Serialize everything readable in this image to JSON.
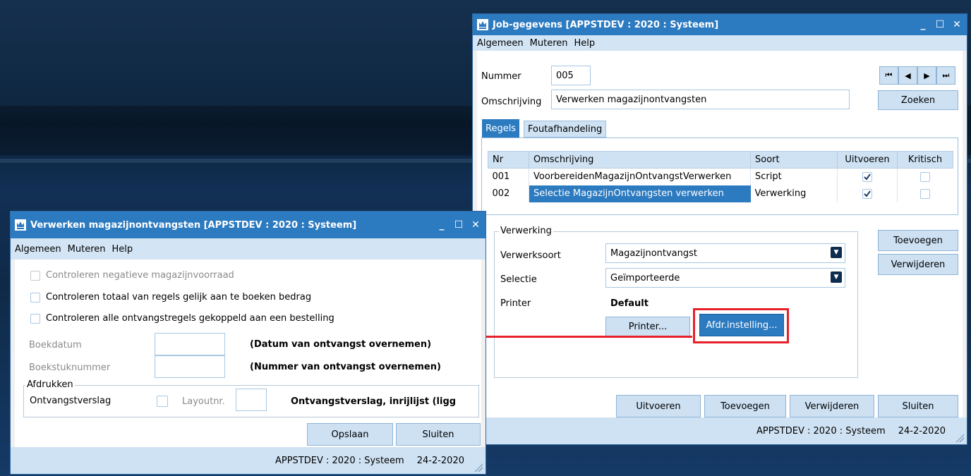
{
  "main_window": {
    "title": "Job-gegevens  [APPSTDEV : 2020 : Systeem]",
    "menu": [
      "Algemeen",
      "Muteren",
      "Help"
    ],
    "nummer_label": "Nummer",
    "nummer_value": "005",
    "omschrijving_label": "Omschrijving",
    "omschrijving_value": "Verwerken magazijnontvangsten",
    "nav_buttons": [
      "⏮",
      "◀",
      "▶",
      "⏭"
    ],
    "zoeken_button": "Zoeken",
    "tabs": [
      "Regels",
      "Foutafhandeling"
    ],
    "grid": {
      "columns": [
        "Nr",
        "Omschrijving",
        "Soort",
        "Uitvoeren",
        "Kritisch"
      ],
      "rows": [
        {
          "nr": "001",
          "omschrijving": "VoorbereidenMagazijnOntvangstVerwerken",
          "soort": "Script",
          "uitvoeren": true,
          "kritisch": false
        },
        {
          "nr": "002",
          "omschrijving": "Selectie MagazijnOntvangsten verwerken",
          "soort": "Verwerking",
          "uitvoeren": true,
          "kritisch": false
        }
      ]
    },
    "verwerking_group_label": "Verwerking",
    "verwerkssoort_label": "Verwerksoort",
    "verwerkssoort_value": "Magazijnontvangst",
    "selectie_label": "Selectie",
    "selectie_value": "Geïmporteerde",
    "printer_label": "Printer",
    "printer_value": "Default",
    "printer_button": "Printer...",
    "afdr_button": "Afdr.instelling...",
    "side_buttons": [
      "Toevoegen",
      "Verwijderen"
    ],
    "bottom_buttons": [
      "Uitvoeren",
      "Toevoegen",
      "Verwijderen",
      "Sluiten"
    ],
    "status_text": "APPSTDEV : 2020 : Systeem",
    "status_date": "24-2-2020"
  },
  "sub_window": {
    "title": "Verwerken magazijnontvangsten  [APPSTDEV : 2020 : Systeem]",
    "menu": [
      "Algemeen",
      "Muteren",
      "Help"
    ],
    "checkboxes": [
      {
        "label": "Controleren negatieve magazijnvoorraad",
        "disabled": true,
        "checked": false
      },
      {
        "label": "Controleren totaal van regels gelijk aan te boeken bedrag",
        "disabled": false,
        "checked": false
      },
      {
        "label": "Controleren alle ontvangstregels gekoppeld aan een bestelling",
        "disabled": false,
        "checked": false
      }
    ],
    "boekdatum_label": "Boekdatum",
    "boekdatum_note": "(Datum van ontvangst overnemen)",
    "boekstuk_label": "Boekstuknummer",
    "boekstuk_note": "(Nummer van ontvangst overnemen)",
    "afdrukken_label": "Afdrukken",
    "ontvangstverslag_label": "Ontvangstverslag",
    "layoutnr_label": "Layoutnr.",
    "ontvangstverslag_note": "Ontvangstverslag, inrijlijst (ligg",
    "buttons": [
      "Opslaan",
      "Sluiten"
    ],
    "status_text": "APPSTDEV : 2020 : Systeem",
    "status_date": "24-2-2020"
  },
  "colors": {
    "titlebar": "#2c7ac0",
    "highlight": "#2c7ac0",
    "annotation": "#e8202a"
  }
}
